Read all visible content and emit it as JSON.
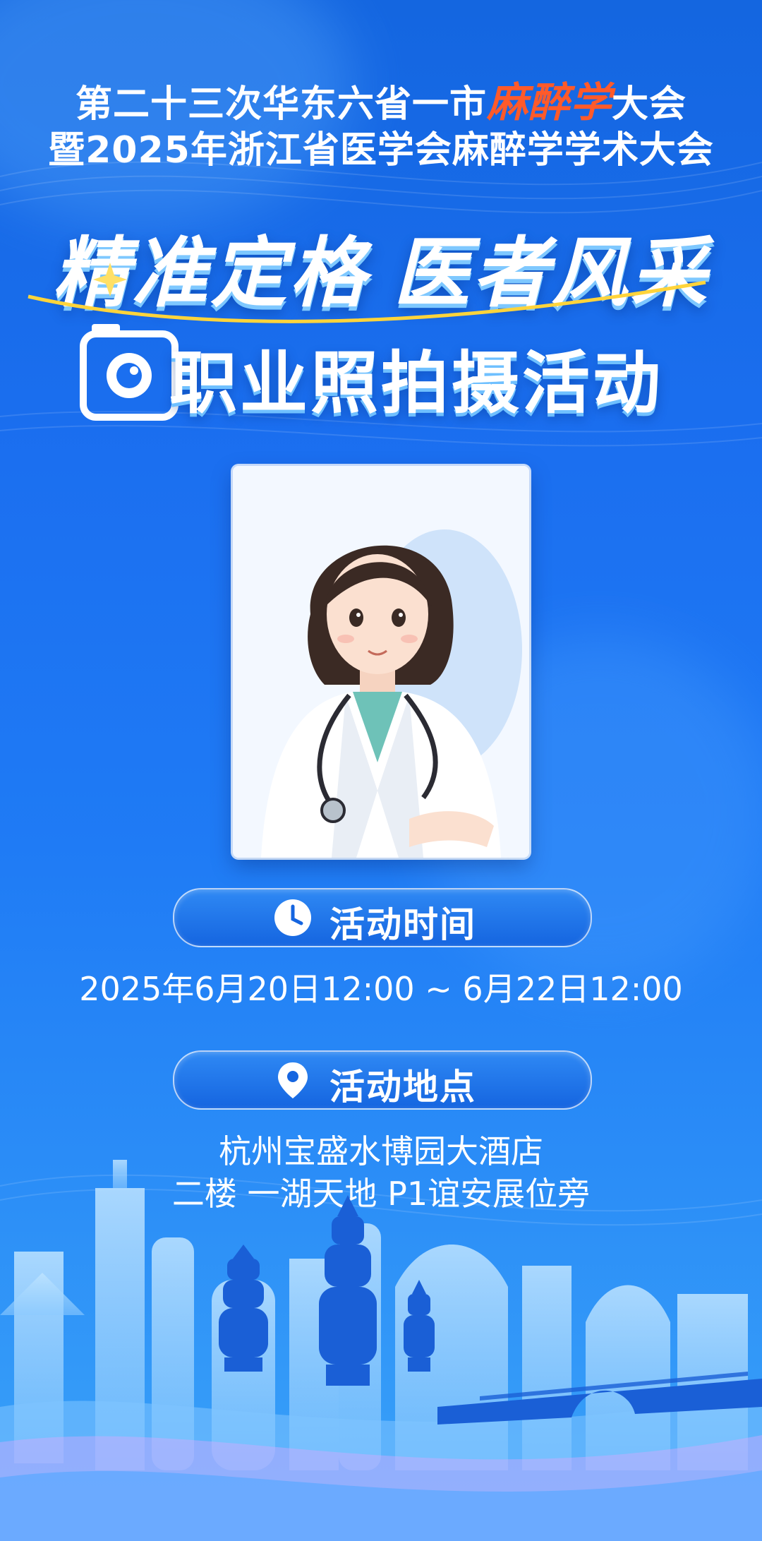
{
  "header": {
    "line1_prefix": "第二十三次华东六省一市",
    "line1_highlight": "麻醉学",
    "line1_suffix": "大会",
    "line2": "暨2025年浙江省医学会麻醉学学术大会"
  },
  "slogan": {
    "part1": "精准定格",
    "part2": "医者风采"
  },
  "subtitle": "职业照拍摄活动",
  "time_section": {
    "label": "活动时间",
    "value": "2025年6月20日12:00 ~ 6月22日12:00"
  },
  "location_section": {
    "label": "活动地点",
    "line1": "杭州宝盛水博园大酒店",
    "line2": "二楼 一湖天地   P1谊安展位旁"
  },
  "colors": {
    "background": "#1b6ff0",
    "highlight": "#ff5a2a",
    "pill": "#1565e0"
  },
  "icons": [
    "camera-icon",
    "clock-icon",
    "location-pin-icon"
  ]
}
